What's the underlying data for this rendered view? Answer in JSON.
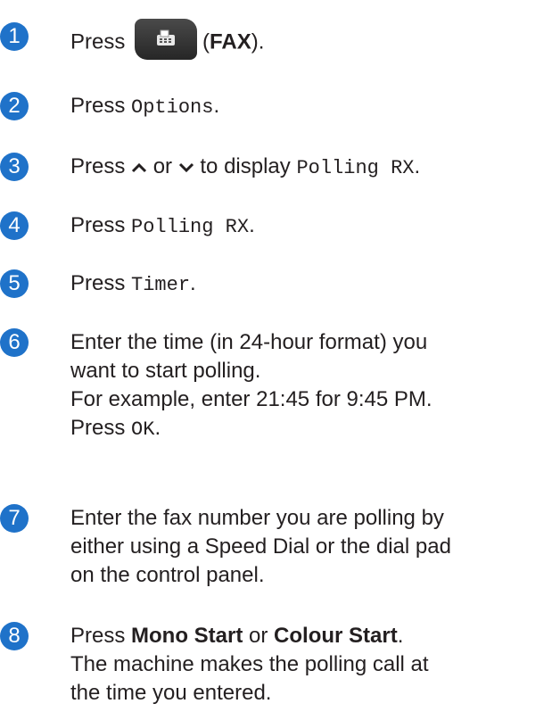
{
  "steps": [
    {
      "num": "1",
      "press": "Press",
      "open": "(",
      "fax": "FAX",
      "close": ")."
    },
    {
      "num": "2",
      "press": "Press",
      "options": "Options",
      "end": "."
    },
    {
      "num": "3",
      "press": "Press",
      "or": "or",
      "to_display": "to display",
      "polling": "Polling RX",
      "end": "."
    },
    {
      "num": "4",
      "press": "Press",
      "polling": "Polling RX",
      "end": "."
    },
    {
      "num": "5",
      "press": "Press",
      "timer": "Timer",
      "end": "."
    },
    {
      "num": "6",
      "line1": "Enter the time (in 24-hour format) you",
      "line2": "want to start polling.",
      "line3": "For example, enter 21:45 for 9:45 PM.",
      "press": "Press",
      "ok": "OK",
      "end": "."
    },
    {
      "num": "7",
      "line1": "Enter the fax number you are polling by",
      "line2": "either using a Speed Dial or the dial pad",
      "line3": "on the control panel."
    },
    {
      "num": "8",
      "press": "Press",
      "mono_start": "Mono Start",
      "or": "or",
      "colour_start": "Colour Start",
      "end": ".",
      "line2": "The machine makes the polling call at",
      "line3": "the time you entered."
    }
  ],
  "icons": {
    "fax_button": "fax-machine-icon",
    "up": "chevron-up-icon",
    "down": "chevron-down-icon"
  },
  "colors": {
    "badge": "#1f72c9",
    "button": "#333333"
  }
}
